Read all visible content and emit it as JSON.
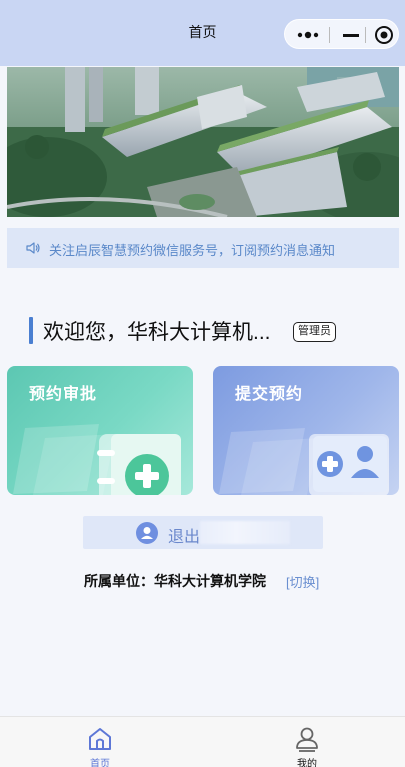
{
  "header": {
    "title": "首页"
  },
  "notice": {
    "text": "关注启辰智慧预约微信服务号，订阅预约消息通知"
  },
  "welcome": {
    "text": "欢迎您，华科大计算机...",
    "role": "管理员"
  },
  "cards": {
    "approve": {
      "label": "预约审批"
    },
    "submit": {
      "label": "提交预约"
    }
  },
  "logout": {
    "label": "退出"
  },
  "affiliation": {
    "text": "所属单位：华科大计算机学院",
    "switch_label": "[切换]"
  },
  "tabbar": {
    "home": {
      "label": "首页",
      "active": true
    },
    "mine": {
      "label": "我的",
      "active": false
    }
  },
  "colors": {
    "header_bg": "#c9d6f3",
    "accent": "#5d77d6",
    "approve_card": "#5cc7b2",
    "submit_card": "#7d9be0"
  }
}
